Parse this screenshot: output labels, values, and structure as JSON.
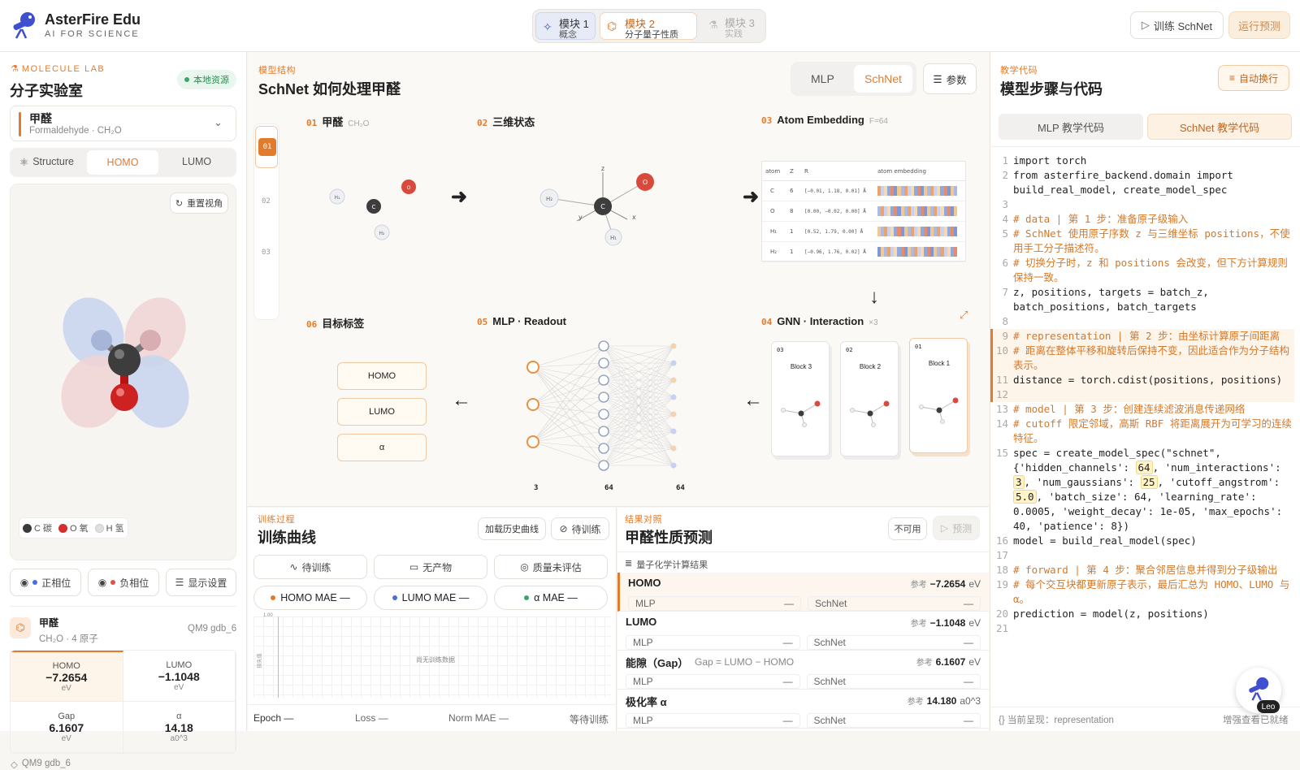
{
  "brand": {
    "name": "AsterFire Edu",
    "tagline": "AI FOR SCIENCE"
  },
  "modules": [
    {
      "num": "模块 1",
      "sub": "概念"
    },
    {
      "num": "模块 2",
      "sub": "分子量子性质"
    },
    {
      "num": "模块 3",
      "sub": "实践"
    }
  ],
  "top_actions": {
    "train": "训练 SchNet",
    "predict": "运行预测"
  },
  "left": {
    "kicker": "MOLECULE LAB",
    "title": "分子实验室",
    "badge": "本地资源",
    "molecule": {
      "name": "甲醛",
      "english": "Formaldehyde · CH₂O"
    },
    "tabs": [
      "Structure",
      "HOMO",
      "LUMO"
    ],
    "reset": "重置视角",
    "legend": [
      {
        "label": "C 碳",
        "color": "#3a3a3a"
      },
      {
        "label": "O 氧",
        "color": "#d32f2f"
      },
      {
        "label": "H 氢",
        "color": "#e0e0e0"
      }
    ],
    "toggles": [
      "正相位",
      "负相位",
      "显示设置"
    ],
    "info": {
      "name": "甲醛",
      "formula": "CH₂O · 4 原子",
      "source": "QM9 gdb_6"
    },
    "props": [
      {
        "k": "HOMO",
        "v": "−7.2654",
        "u": "eV"
      },
      {
        "k": "LUMO",
        "v": "−1.1048",
        "u": "eV"
      },
      {
        "k": "Gap",
        "v": "6.1607",
        "u": "eV"
      },
      {
        "k": "α",
        "v": "14.18",
        "u": "a0^3"
      }
    ],
    "footer": "QM9 gdb_6"
  },
  "model": {
    "kicker": "模型结构",
    "title": "SchNet 如何处理甲醛",
    "tabs": [
      "MLP",
      "SchNet"
    ],
    "params": "参数",
    "steps_nav": [
      "01",
      "02",
      "03"
    ],
    "s01": {
      "n": "01",
      "t": "甲醛",
      "sub": "CH₂O"
    },
    "s02": {
      "n": "02",
      "t": "三维状态"
    },
    "s03": {
      "n": "03",
      "t": "Atom Embedding",
      "sub": "F=64"
    },
    "s04": {
      "n": "04",
      "t": "GNN · Interaction",
      "sub": "×3"
    },
    "s05": {
      "n": "05",
      "t": "MLP · Readout"
    },
    "s06": {
      "n": "06",
      "t": "目标标签"
    },
    "atoms": {
      "c": "C",
      "o": "O",
      "h1": "H₁",
      "h2": "H₂",
      "x": "x",
      "y": "y",
      "z": "z"
    },
    "embed": {
      "head": [
        "atom",
        "Z",
        "R",
        "atom embedding"
      ],
      "rows": [
        [
          "C",
          "6",
          "[−0.01, 1.18, 0.01] Å"
        ],
        [
          "O",
          "8",
          "[0.00, −0.02, 0.00] Å"
        ],
        [
          "H₁",
          "1",
          "[0.52, 1.79, 0.00] Å"
        ],
        [
          "H₂",
          "1",
          "[−0.96, 1.76, 0.02] Å"
        ]
      ]
    },
    "blocks": [
      {
        "n": "03",
        "t": "Block 3"
      },
      {
        "n": "02",
        "t": "Block 2"
      },
      {
        "n": "01",
        "t": "Block 1"
      }
    ],
    "layers": [
      "3",
      "64",
      "64"
    ],
    "targets": [
      "HOMO",
      "LUMO",
      "α"
    ]
  },
  "training": {
    "kicker": "训练过程",
    "title": "训练曲线",
    "load": "加载历史曲线",
    "status": "待训练",
    "chips": [
      "待训练",
      "无产物",
      "质量未评估"
    ],
    "metrics": [
      {
        "label": "HOMO MAE —",
        "color": "#e37b2c"
      },
      {
        "label": "LUMO MAE —",
        "color": "#4a6fd8"
      },
      {
        "label": "α MAE —",
        "color": "#3aa56b"
      }
    ],
    "ytick": "1.00",
    "yaxis": "损失值",
    "empty": "尚无训练数据",
    "foot": [
      "Epoch —",
      "Loss —",
      "Norm MAE —",
      "等待训练"
    ]
  },
  "results": {
    "kicker": "结果对照",
    "title": "甲醛性质预测",
    "unavailable": "不可用",
    "predict": "预测",
    "section": "量子化学计算结果",
    "rows": [
      {
        "name": "HOMO",
        "note": "",
        "ref": "参考",
        "val": "−7.2654",
        "unit": "eV"
      },
      {
        "name": "LUMO",
        "note": "",
        "ref": "参考",
        "val": "−1.1048",
        "unit": "eV"
      },
      {
        "name": "能隙（Gap）",
        "note": "Gap = LUMO − HOMO",
        "ref": "参考",
        "val": "6.1607",
        "unit": "eV"
      },
      {
        "name": "极化率 α",
        "note": "",
        "ref": "参考",
        "val": "14.180",
        "unit": "a0^3"
      }
    ],
    "mlp": "MLP",
    "schnet": "SchNet",
    "dash": "—"
  },
  "code": {
    "kicker": "教学代码",
    "title": "模型步骤与代码",
    "wrap": "自动换行",
    "tabs": [
      "MLP 教学代码",
      "SchNet 教学代码"
    ],
    "lines": [
      {
        "n": "1",
        "t": "import torch"
      },
      {
        "n": "2",
        "t": "from asterfire_backend.domain import build_real_model, create_model_spec"
      },
      {
        "n": "3",
        "t": ""
      },
      {
        "n": "4",
        "t": "# data | 第 1 步：准备原子级输入",
        "c": true
      },
      {
        "n": "5",
        "t": "# SchNet 使用原子序数 z 与三维坐标 positions，不使用手工分子描述符。",
        "c": true
      },
      {
        "n": "6",
        "t": "# 切换分子时，z 和 positions 会改变，但下方计算规则保持一致。",
        "c": true
      },
      {
        "n": "7",
        "t": "z, positions, targets = batch_z, batch_positions, batch_targets"
      },
      {
        "n": "8",
        "t": ""
      },
      {
        "n": "9",
        "t": "# representation | 第 2 步：由坐标计算原子间距离",
        "c": true,
        "hl": true
      },
      {
        "n": "10",
        "t": "# 距离在整体平移和旋转后保持不变，因此适合作为分子结构表示。",
        "c": true,
        "hl": true
      },
      {
        "n": "11",
        "t": "distance = torch.cdist(positions, positions)",
        "hl": true
      },
      {
        "n": "12",
        "t": "",
        "hl": true
      },
      {
        "n": "13",
        "t": "# model | 第 3 步：创建连续滤波消息传递网络",
        "c": true
      },
      {
        "n": "14",
        "t": "# cutoff 限定邻域，高斯 RBF 将距离展开为可学习的连续特征。",
        "c": true
      },
      {
        "n": "15",
        "t": "spec = create_model_spec(\"schnet\", {'hidden_channels': 64, 'num_interactions': 3, 'num_gaussians': 25, 'cutoff_angstrom': 5.0, 'batch_size': 64, 'learning_rate': 0.0005, 'weight_decay': 1e-05, 'max_epochs': 40, 'patience': 8})"
      },
      {
        "n": "16",
        "t": "model = build_real_model(spec)"
      },
      {
        "n": "17",
        "t": ""
      },
      {
        "n": "18",
        "t": "# forward | 第 4 步：聚合邻居信息并得到分子级输出",
        "c": true
      },
      {
        "n": "19",
        "t": "# 每个交互块都更新原子表示，最后汇总为 HOMO、LUMO 与 α。",
        "c": true
      },
      {
        "n": "20",
        "t": "prediction = model(z, positions)"
      },
      {
        "n": "21",
        "t": ""
      }
    ],
    "status": "{} 当前呈现：representation",
    "status_right": "增强查看已就绪",
    "avatar": "Leo"
  }
}
